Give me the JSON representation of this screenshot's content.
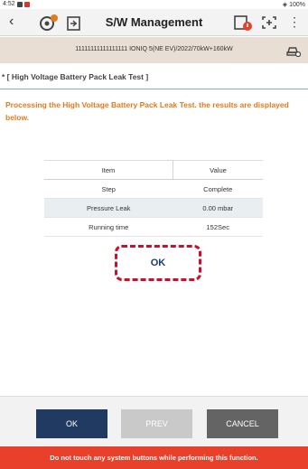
{
  "status_bar": {
    "time": "4:52",
    "battery": "100%"
  },
  "header": {
    "title": "S/W Management"
  },
  "vehicle_info": {
    "text": "11111111111111111  IONIQ 5(NE EV)/2022/70kW+160kW"
  },
  "section": {
    "title": "* [ High Voltage Battery Pack Leak Test ]"
  },
  "description": "Processing the High Voltage Battery Pack Leak Test. the results are displayed below.",
  "table": {
    "headers": [
      "Item",
      "Value"
    ],
    "rows": [
      [
        "Step",
        "Complete"
      ],
      [
        "Pressure Leak",
        "0.00 mbar"
      ],
      [
        "Running time",
        "152Sec"
      ]
    ]
  },
  "result": {
    "text": "OK"
  },
  "buttons": {
    "ok": "OK",
    "prev": "PREV",
    "cancel": "CANCEL"
  },
  "footer": {
    "warning": "Do not touch any system buttons while performing this function."
  },
  "colors": {
    "accent_orange": "#e07b1e",
    "ok_button": "#213a61",
    "warning_red": "#e8402b",
    "highlight_red": "#c8102e"
  }
}
